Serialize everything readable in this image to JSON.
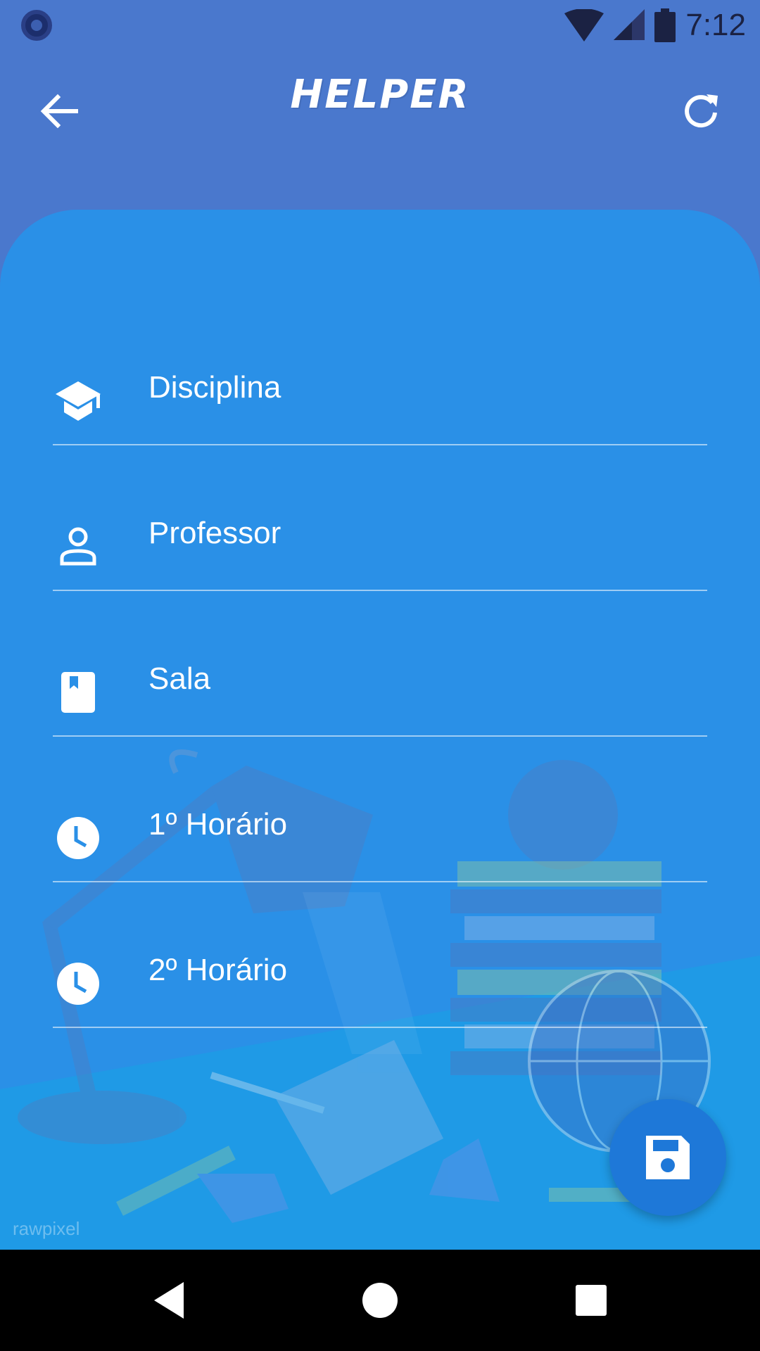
{
  "status_bar": {
    "time": "7:12",
    "icons": [
      "wifi-icon",
      "signal-icon",
      "battery-icon"
    ]
  },
  "toolbar": {
    "title": "HELPER",
    "back_icon": "arrow-left-icon",
    "refresh_icon": "refresh-icon"
  },
  "form": {
    "fields": [
      {
        "label": "Disciplina",
        "icon": "graduation-cap-icon"
      },
      {
        "label": "Professor",
        "icon": "person-icon"
      },
      {
        "label": "Sala",
        "icon": "book-icon"
      },
      {
        "label": "1º Horário",
        "icon": "clock-icon"
      },
      {
        "label": "2º Horário",
        "icon": "clock-icon"
      }
    ]
  },
  "fab": {
    "icon": "save-icon"
  },
  "background": {
    "watermark": "rawpixel"
  },
  "nav_bar": {
    "icons": [
      "back-triangle-icon",
      "home-circle-icon",
      "recents-square-icon"
    ]
  },
  "colors": {
    "header": "#4a78cd",
    "card": "#2a90e7",
    "fab": "#1e78d8",
    "text": "#ffffff"
  }
}
